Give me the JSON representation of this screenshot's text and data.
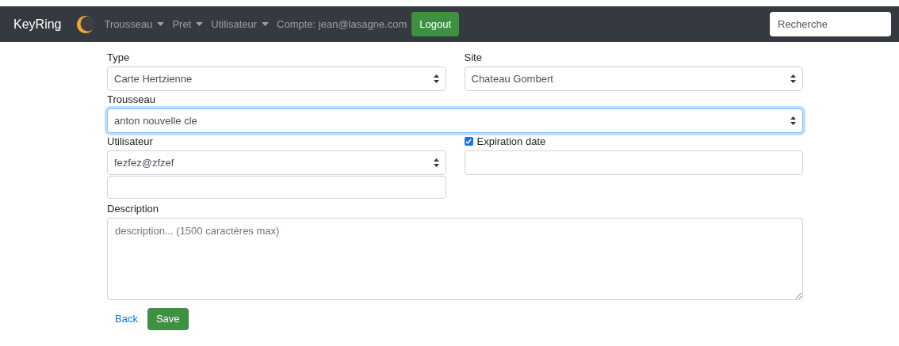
{
  "navbar": {
    "brand": "KeyRing",
    "menus": [
      {
        "label": "Trousseau"
      },
      {
        "label": "Pret"
      },
      {
        "label": "Utilisateur"
      }
    ],
    "account": "Compte: jean@lasagne.com",
    "logout": "Logout",
    "search": {
      "placeholder": "Recherche"
    }
  },
  "form": {
    "type": {
      "label": "Type",
      "value": "Carte Hertzienne"
    },
    "site": {
      "label": "Site",
      "value": "Chateau Gombert"
    },
    "trousseau": {
      "label": "Trousseau",
      "value": "anton nouvelle cle",
      "focused": true
    },
    "utilisateur": {
      "label": "Utilisateur",
      "value": "fezfez@zfzef"
    },
    "expiration": {
      "label": "Expiration date",
      "checked": true
    },
    "description": {
      "label": "Description",
      "placeholder": "description... (1500 caractères max)"
    },
    "back": "Back",
    "save": "Save"
  }
}
